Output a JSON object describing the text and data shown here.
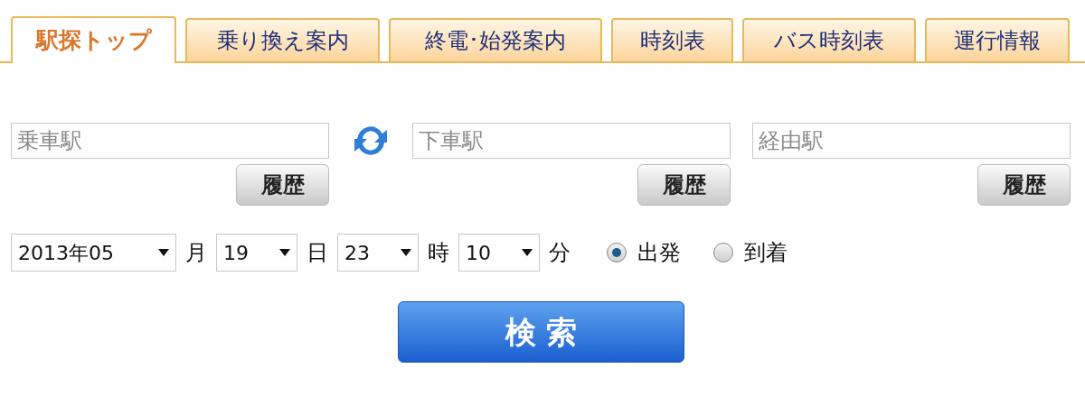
{
  "tabs": [
    {
      "label": "駅探トップ",
      "selected": true
    },
    {
      "label": "乗り換え案内",
      "selected": false
    },
    {
      "label": "終電･始発案内",
      "selected": false
    },
    {
      "label": "時刻表",
      "selected": false
    },
    {
      "label": "バス時刻表",
      "selected": false
    },
    {
      "label": "運行情報",
      "selected": false
    }
  ],
  "stations": [
    {
      "placeholder": "乗車駅",
      "history_button": "履歴"
    },
    {
      "placeholder": "下車駅",
      "history_button": "履歴"
    },
    {
      "placeholder": "経由駅",
      "history_button": "履歴"
    }
  ],
  "datetime": [
    {
      "value": "2013年05",
      "unit": "月"
    },
    {
      "value": "19",
      "unit": "日"
    },
    {
      "value": "23",
      "unit": "時"
    },
    {
      "value": "10",
      "unit": "分"
    }
  ],
  "mode": [
    {
      "label": "出発",
      "selected": true
    },
    {
      "label": "到着",
      "selected": false
    }
  ],
  "search_button": "検 索"
}
